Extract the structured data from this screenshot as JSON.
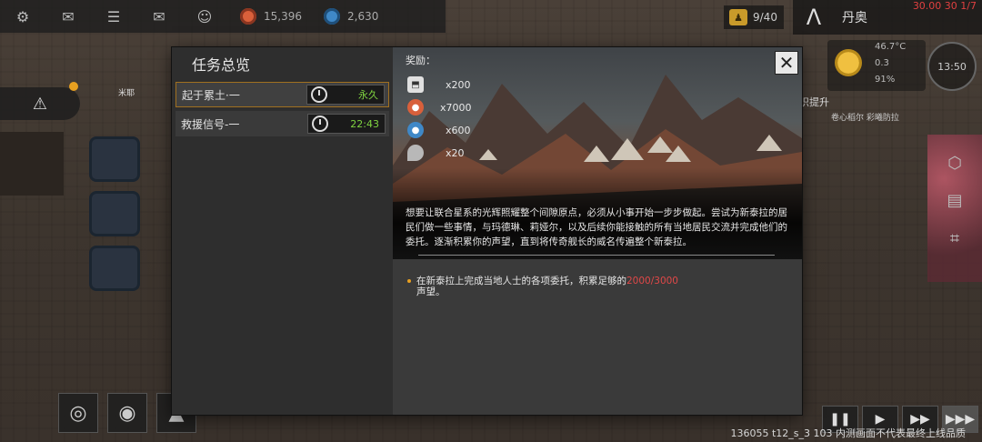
{
  "hud": {
    "resources": [
      {
        "icon": "orange-credit-icon",
        "value": "15,396",
        "color": "#d9603b"
      },
      {
        "icon": "blue-research-icon",
        "value": "2,630",
        "color": "#3f88c7"
      }
    ],
    "population": "9/40",
    "planet_name": "丹奥",
    "clock": "30.00 30 1/7",
    "weather": {
      "temperature": "46.7°C",
      "wind": "0.3",
      "humidity": "91%"
    },
    "time": "13:50"
  },
  "alerts": {
    "npc_name": "米耶",
    "notice": "意识提升",
    "notice_sub": "卷心稻尔 彩曦防拉"
  },
  "modal": {
    "title": "任务总览",
    "quests": [
      {
        "name": "起于累土·一",
        "timer": "永久",
        "selected": true
      },
      {
        "name": "救援信号-一",
        "timer": "22:43",
        "selected": false
      }
    ],
    "reward_label": "奖励：",
    "rewards": [
      {
        "icon": "research-item-icon",
        "amount": "x200"
      },
      {
        "icon": "orange-credit-icon",
        "amount": "x7000"
      },
      {
        "icon": "blue-research-icon",
        "amount": "x600"
      },
      {
        "icon": "mineral-icon",
        "amount": "x20"
      }
    ],
    "description": "想要让联合星系的光辉照耀整个间隙原点，必须从小事开始一步步做起。尝试为新泰拉的居民们做一些事情，与玛德琳、莉娅尔，以及后续你能接触的所有当地居民交流并完成他们的委托。逐渐积累你的声望，直到将传奇舰长的威名传遍整个新泰拉。",
    "objective_before": "在新泰拉上完成当地人士的各项委托，积累足够的",
    "objective_progress": "2000/3000",
    "objective_after": "声望。",
    "close_glyph": "✕"
  },
  "controls": {
    "pause_glyph": "❚❚",
    "play_glyph": "▶",
    "fast_glyph": "▶▶",
    "faster_glyph": "▶▶▶"
  },
  "version": "136055 t12_s_3 103  内测画面不代表最终上线品质"
}
